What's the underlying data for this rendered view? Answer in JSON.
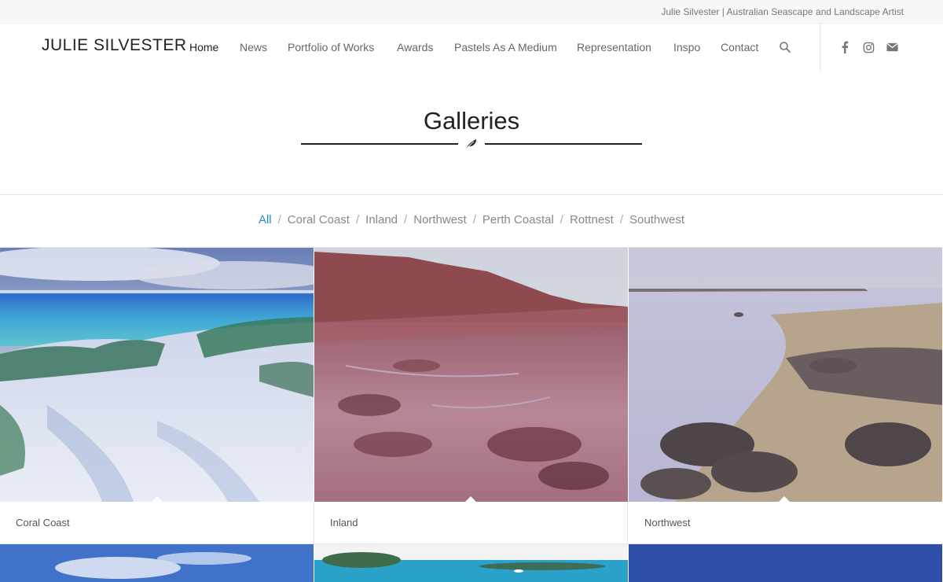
{
  "topbar": {
    "text": "Julie Silvester | Australian Seascape and Landscape Artist"
  },
  "header": {
    "logo": "JULIE SILVESTER",
    "nav": [
      {
        "label": "Home",
        "active": true
      },
      {
        "label": "News"
      },
      {
        "label": "Portfolio of Works"
      },
      {
        "label": "Awards"
      },
      {
        "label": "Pastels As A Medium"
      },
      {
        "label": "Representation"
      },
      {
        "label": "Inspo"
      },
      {
        "label": "Contact"
      }
    ],
    "icons": [
      "search-icon",
      "facebook-icon",
      "instagram-icon",
      "mail-icon"
    ]
  },
  "page": {
    "title": "Galleries",
    "divider_icon": "leaf-icon"
  },
  "filters": {
    "items": [
      "All",
      "Coral Coast",
      "Inland",
      "Northwest",
      "Perth Coastal",
      "Rottnest",
      "Southwest"
    ],
    "active": "All",
    "separator": "/"
  },
  "gallery": {
    "cards": [
      {
        "caption": "Coral Coast"
      },
      {
        "caption": "Inland"
      },
      {
        "caption": "Northwest"
      }
    ]
  },
  "colors": {
    "accent": "#1f8fc4",
    "text": "#333333",
    "topbar_bg": "#f8f8f8"
  }
}
